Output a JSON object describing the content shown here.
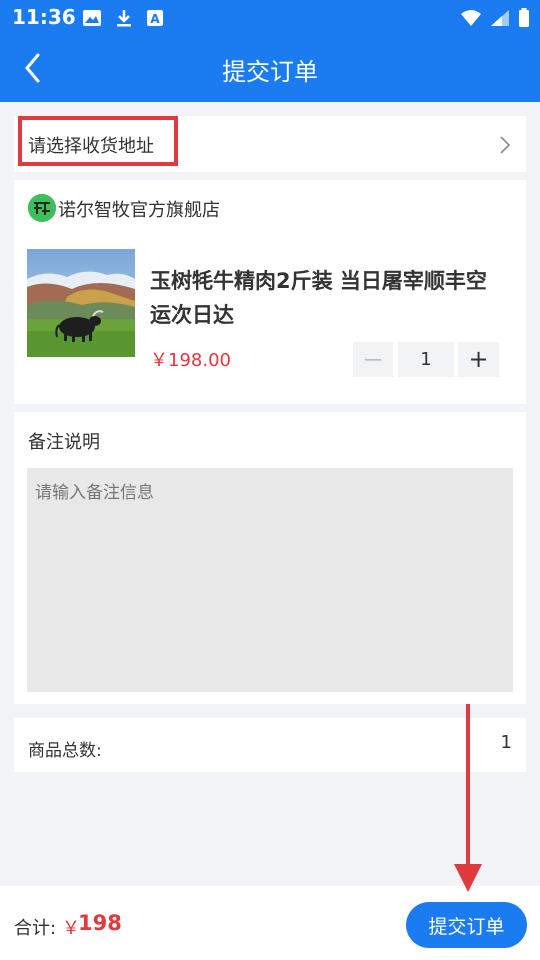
{
  "status_bar": {
    "time": "11:36",
    "icons_left": [
      "image-icon",
      "download-icon",
      "a-icon"
    ],
    "icons_right": [
      "wifi-icon",
      "signal-icon",
      "battery-icon"
    ]
  },
  "header": {
    "title": "提交订单",
    "back_icon": "back-chevron-icon"
  },
  "address": {
    "placeholder": "请选择收货地址",
    "chevron_icon": "chevron-right-icon",
    "highlight_color": "#e0393e"
  },
  "shop": {
    "logo_glyph": "𝔉",
    "name": "诺尔智牧官方旗舰店"
  },
  "product": {
    "name": "玉树牦牛精肉2斤装 当日屠宰顺丰空运次日达",
    "price": "￥198.00",
    "quantity": "1",
    "minus_label": "—",
    "plus_label": "+"
  },
  "note": {
    "title": "备注说明",
    "placeholder": "请输入备注信息"
  },
  "count": {
    "label": "商品总数:",
    "value": "1"
  },
  "footer": {
    "total_label": "合计:",
    "currency": "￥",
    "total_value": "198",
    "submit_label": "提交订单"
  },
  "colors": {
    "primary": "#1a7cf0",
    "price": "#e0393e",
    "annotation": "#e0393e"
  }
}
